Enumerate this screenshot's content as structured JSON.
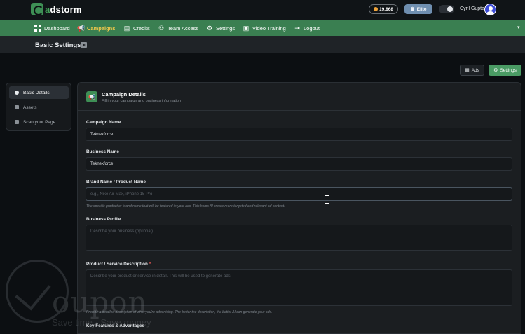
{
  "brand": {
    "name_prefix": "a",
    "name_rest": "dstorm"
  },
  "header": {
    "credits": "19,868",
    "plan": "Elite",
    "user_name": "Cyril Gupta"
  },
  "nav": {
    "items": [
      {
        "label": "Dashboard",
        "icon": "dashboard-icon"
      },
      {
        "label": "Campaigns",
        "icon": "megaphone-icon",
        "active": true
      },
      {
        "label": "Credits",
        "icon": "credits-icon"
      },
      {
        "label": "Team Access",
        "icon": "team-icon"
      },
      {
        "label": "Settings",
        "icon": "gear-icon"
      },
      {
        "label": "Video Training",
        "icon": "video-icon"
      },
      {
        "label": "Logout",
        "icon": "logout-icon"
      }
    ]
  },
  "page": {
    "title": "Basic Settings"
  },
  "actions": {
    "ads_label": "Ads",
    "settings_label": "Settings"
  },
  "steps": [
    {
      "label": "Basic Details",
      "active": true
    },
    {
      "label": "Assets"
    },
    {
      "label": "Scan your Page"
    }
  ],
  "card": {
    "title": "Campaign Details",
    "subtitle": "Fill in your campaign and business information"
  },
  "form": {
    "campaign_name": {
      "label": "Campaign Name",
      "value": "Teknekforce"
    },
    "business_name": {
      "label": "Business Name",
      "value": "Teknekforce"
    },
    "brand_name": {
      "label": "Brand Name / Product Name",
      "placeholder": "e.g., Nike Air Max, iPhone 15 Pro",
      "help": "The specific product or brand name that will be featured in your ads. This helps AI create more targeted and relevant ad content."
    },
    "business_profile": {
      "label": "Business Profile",
      "placeholder": "Describe your business (optional)"
    },
    "product_description": {
      "label": "Product / Service Description",
      "required_mark": "*",
      "placeholder": "Describe your product or service in detail. This will be used to generate ads.",
      "help": "Provide a detailed description of what you're advertising. The better the description, the better AI can generate your ads."
    },
    "key_features": {
      "label": "Key Features & Advantages"
    }
  },
  "watermark": {
    "word": "oupon",
    "tagline": "Save time · Save money"
  }
}
